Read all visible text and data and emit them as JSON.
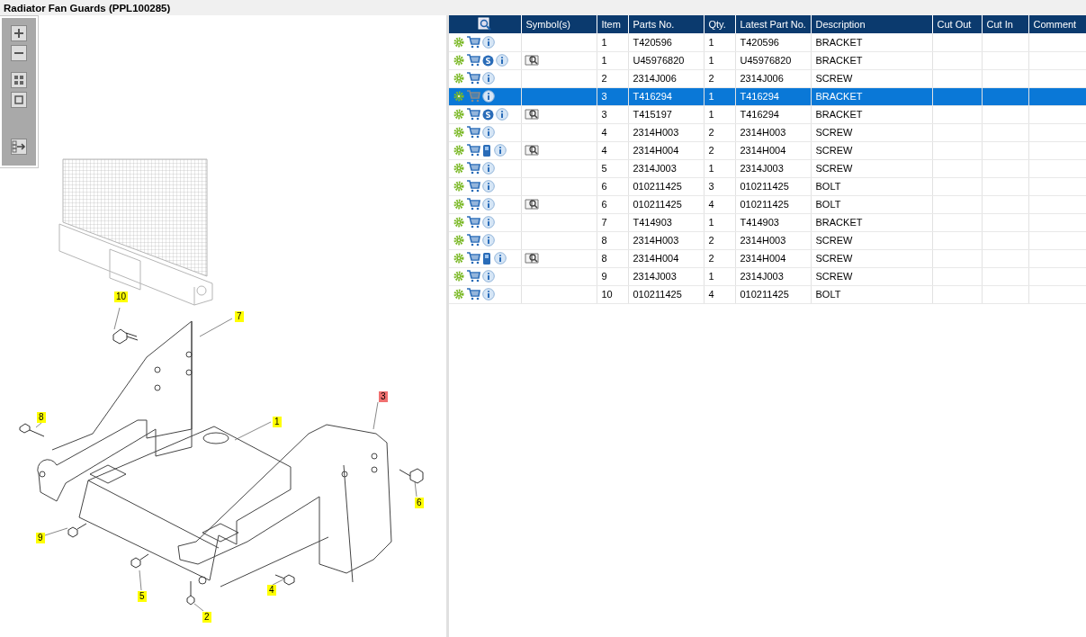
{
  "title": "Radiator Fan Guards (PPL100285)",
  "callouts": [
    {
      "label": "10",
      "selected": false
    },
    {
      "label": "7",
      "selected": false
    },
    {
      "label": "8",
      "selected": false
    },
    {
      "label": "1",
      "selected": false
    },
    {
      "label": "3",
      "selected": true
    },
    {
      "label": "6",
      "selected": false
    },
    {
      "label": "9",
      "selected": false
    },
    {
      "label": "5",
      "selected": false
    },
    {
      "label": "4",
      "selected": false
    },
    {
      "label": "2",
      "selected": false
    }
  ],
  "table": {
    "columns": [
      "",
      "Symbol(s)",
      "Item",
      "Parts No.",
      "Qty.",
      "Latest Part No.",
      "Description",
      "Cut Out",
      "Cut In",
      "Comment"
    ],
    "rows": [
      {
        "s_badge": false,
        "manual": false,
        "symbol": false,
        "selected": false,
        "cells": [
          "",
          "",
          "1",
          "T420596",
          "1",
          "T420596",
          "BRACKET"
        ]
      },
      {
        "s_badge": true,
        "manual": false,
        "symbol": true,
        "selected": false,
        "cells": [
          "",
          "",
          "1",
          "U45976820",
          "1",
          "U45976820",
          "BRACKET"
        ]
      },
      {
        "s_badge": false,
        "manual": false,
        "symbol": false,
        "selected": false,
        "cells": [
          "",
          "",
          "2",
          "2314J006",
          "2",
          "2314J006",
          "SCREW"
        ]
      },
      {
        "s_badge": false,
        "manual": false,
        "symbol": false,
        "selected": true,
        "cells": [
          "",
          "",
          "3",
          "T416294",
          "1",
          "T416294",
          "BRACKET"
        ]
      },
      {
        "s_badge": true,
        "manual": false,
        "symbol": true,
        "selected": false,
        "cells": [
          "",
          "",
          "3",
          "T415197",
          "1",
          "T416294",
          "BRACKET"
        ]
      },
      {
        "s_badge": false,
        "manual": false,
        "symbol": false,
        "selected": false,
        "cells": [
          "",
          "",
          "4",
          "2314H003",
          "2",
          "2314H003",
          "SCREW"
        ]
      },
      {
        "s_badge": false,
        "manual": true,
        "symbol": true,
        "selected": false,
        "cells": [
          "",
          "",
          "4",
          "2314H004",
          "2",
          "2314H004",
          "SCREW"
        ]
      },
      {
        "s_badge": false,
        "manual": false,
        "symbol": false,
        "selected": false,
        "cells": [
          "",
          "",
          "5",
          "2314J003",
          "1",
          "2314J003",
          "SCREW"
        ]
      },
      {
        "s_badge": false,
        "manual": false,
        "symbol": false,
        "selected": false,
        "cells": [
          "",
          "",
          "6",
          "010211425",
          "3",
          "010211425",
          "BOLT"
        ]
      },
      {
        "s_badge": false,
        "manual": false,
        "symbol": true,
        "selected": false,
        "cells": [
          "",
          "",
          "6",
          "010211425",
          "4",
          "010211425",
          "BOLT"
        ]
      },
      {
        "s_badge": false,
        "manual": false,
        "symbol": false,
        "selected": false,
        "cells": [
          "",
          "",
          "7",
          "T414903",
          "1",
          "T414903",
          "BRACKET"
        ]
      },
      {
        "s_badge": false,
        "manual": false,
        "symbol": false,
        "selected": false,
        "cells": [
          "",
          "",
          "8",
          "2314H003",
          "2",
          "2314H003",
          "SCREW"
        ]
      },
      {
        "s_badge": false,
        "manual": true,
        "symbol": true,
        "selected": false,
        "cells": [
          "",
          "",
          "8",
          "2314H004",
          "2",
          "2314H004",
          "SCREW"
        ]
      },
      {
        "s_badge": false,
        "manual": false,
        "symbol": false,
        "selected": false,
        "cells": [
          "",
          "",
          "9",
          "2314J003",
          "1",
          "2314J003",
          "SCREW"
        ]
      },
      {
        "s_badge": false,
        "manual": false,
        "symbol": false,
        "selected": false,
        "cells": [
          "",
          "",
          "10",
          "010211425",
          "4",
          "010211425",
          "BOLT"
        ]
      }
    ]
  }
}
